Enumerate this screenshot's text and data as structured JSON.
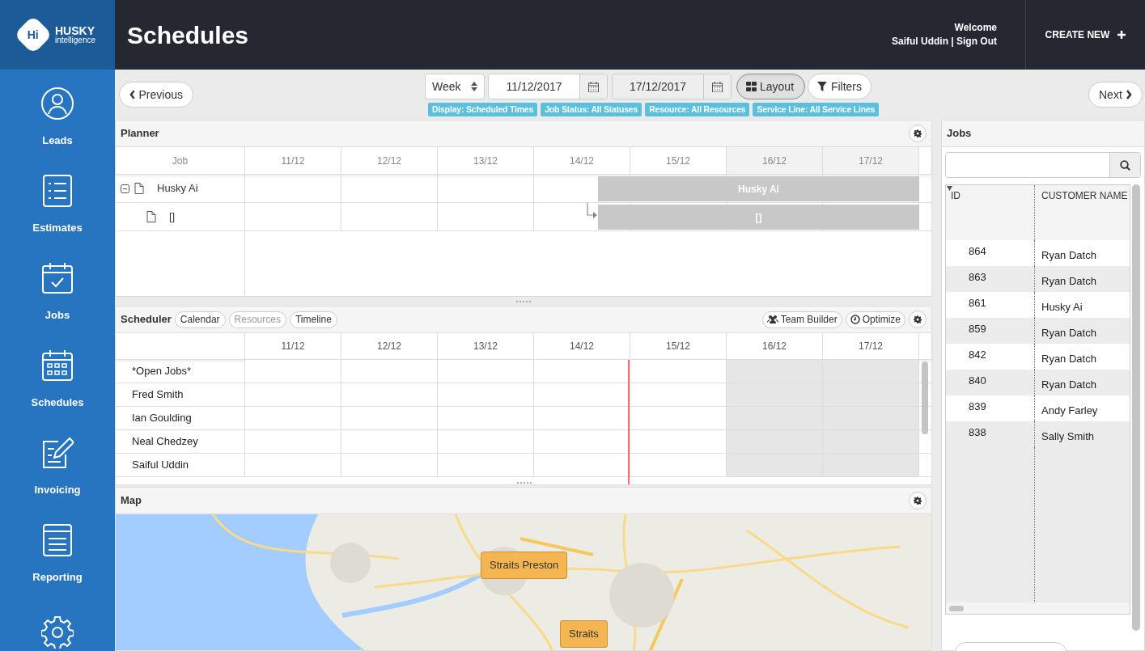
{
  "brand": {
    "logo_mark": "Hi",
    "name": "HUSKY",
    "tagline": "intelligence"
  },
  "sidebar": {
    "items": [
      {
        "label": "Leads",
        "kind": "person"
      },
      {
        "label": "Estimates",
        "kind": "list"
      },
      {
        "label": "Jobs",
        "kind": "calendar-check"
      },
      {
        "label": "Schedules",
        "kind": "calendar-grid"
      },
      {
        "label": "Invoicing",
        "kind": "pencil"
      },
      {
        "label": "Reporting",
        "kind": "document"
      }
    ]
  },
  "header": {
    "title": "Schedules",
    "welcome": "Welcome",
    "user": "Saiful Uddin | Sign Out",
    "create_new": "CREATE NEW"
  },
  "toolbar": {
    "previous": "Previous",
    "next": "Next",
    "period": "Week",
    "start_date": "11/12/2017",
    "end_date": "17/12/2017",
    "layout": {
      "label": "Layout",
      "active": true
    },
    "filters": {
      "label": "Filters",
      "active": false
    },
    "chips": [
      "Display: Scheduled Times",
      "Job Status: All Statuses",
      "Resource: All Resources",
      "Service Line: All Service Lines"
    ]
  },
  "planner": {
    "title": "Planner",
    "job_column": "Job",
    "days": [
      {
        "label": "11/12",
        "weekend": false
      },
      {
        "label": "12/12",
        "weekend": false
      },
      {
        "label": "13/12",
        "weekend": false
      },
      {
        "label": "14/12",
        "weekend": false
      },
      {
        "label": "15/12",
        "weekend": false
      },
      {
        "label": "16/12",
        "weekend": true
      },
      {
        "label": "17/12",
        "weekend": true
      }
    ],
    "rows": [
      {
        "name": "Husky Ai",
        "bar": "Husky Ai",
        "expanded": true,
        "children": [
          {
            "name": "[]",
            "bar": "[]"
          }
        ]
      }
    ]
  },
  "scheduler": {
    "title": "Scheduler",
    "views": [
      {
        "label": "Calendar",
        "disabled": false
      },
      {
        "label": "Resources",
        "disabled": true
      },
      {
        "label": "Timeline",
        "disabled": false
      }
    ],
    "actions": [
      {
        "label": "Team Builder",
        "kind": "team"
      },
      {
        "label": "Optimize",
        "kind": "clock"
      }
    ],
    "days": [
      {
        "label": "11/12",
        "weekend": false
      },
      {
        "label": "12/12",
        "weekend": false
      },
      {
        "label": "13/12",
        "weekend": false
      },
      {
        "label": "14/12",
        "weekend": false
      },
      {
        "label": "15/12",
        "weekend": false
      },
      {
        "label": "16/12",
        "weekend": true
      },
      {
        "label": "17/12",
        "weekend": true
      }
    ],
    "resources": [
      "*Open Jobs*",
      "Fred Smith",
      "Ian Goulding",
      "Neal Chedzey",
      "Saiful Uddin"
    ]
  },
  "map": {
    "title": "Map",
    "markers": [
      {
        "label": "Straits Preston"
      },
      {
        "label": "Straits"
      }
    ]
  },
  "jobs": {
    "title": "Jobs",
    "columns": [
      "ID",
      "CUSTOMER NAME"
    ],
    "rows": [
      {
        "id": "864",
        "customer": "Ryan Datch"
      },
      {
        "id": "863",
        "customer": "Ryan Datch"
      },
      {
        "id": "861",
        "customer": "Husky Ai"
      },
      {
        "id": "859",
        "customer": "Ryan Datch"
      },
      {
        "id": "842",
        "customer": "Ryan Datch"
      },
      {
        "id": "840",
        "customer": "Ryan Datch"
      },
      {
        "id": "839",
        "customer": "Andy Farley"
      },
      {
        "id": "838",
        "customer": "Sally Smith"
      }
    ]
  }
}
